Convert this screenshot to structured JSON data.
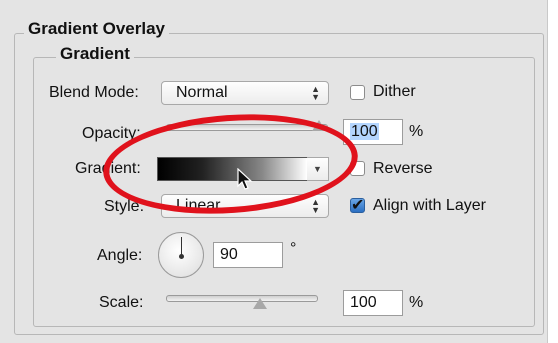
{
  "panel": {
    "section_title": "Gradient Overlay",
    "group_title": "Gradient"
  },
  "blend_mode": {
    "label": "Blend Mode:",
    "value": "Normal"
  },
  "dither": {
    "label": "Dither",
    "checked": false
  },
  "opacity": {
    "label": "Opacity:",
    "value": "100",
    "unit": "%",
    "level": 100
  },
  "gradient": {
    "label": "Gradient:"
  },
  "reverse": {
    "label": "Reverse",
    "checked": false
  },
  "style": {
    "label": "Style:",
    "value": "Linear"
  },
  "align_with_layer": {
    "label": "Align with Layer",
    "checked": true
  },
  "angle": {
    "label": "Angle:",
    "value": "90",
    "unit": "°"
  },
  "scale": {
    "label": "Scale:",
    "value": "100",
    "unit": "%",
    "level": 0.55
  },
  "colors": {
    "highlight": "#e0121c",
    "selection": "#b4d5fe"
  },
  "icons": {
    "cursor": "arrow-pointer-icon",
    "angle_dial": "angle-dial-icon"
  }
}
